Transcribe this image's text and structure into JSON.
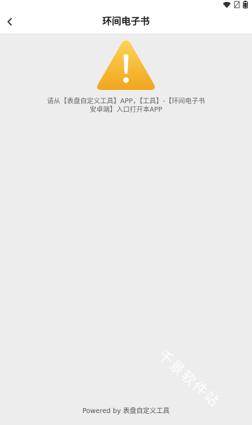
{
  "header": {
    "title": "环间电子书",
    "back_icon": "chevron-left-icon"
  },
  "status_bar": {
    "icons": [
      "wifi-icon",
      "no-sim-icon",
      "battery-icon"
    ]
  },
  "main": {
    "icon": "warning-icon",
    "icon_color": "#f5b126",
    "message_line1": "请从【表盘自定义工具】APP，【工具】-【环间电子书",
    "message_line2": "安卓端】入口打开本APP"
  },
  "watermark": "千景软件站",
  "footer": {
    "text": "Powered by 表盘自定义工具"
  },
  "colors": {
    "background": "#ededed",
    "header_bg": "#ffffff",
    "accent": "#f5b126"
  }
}
